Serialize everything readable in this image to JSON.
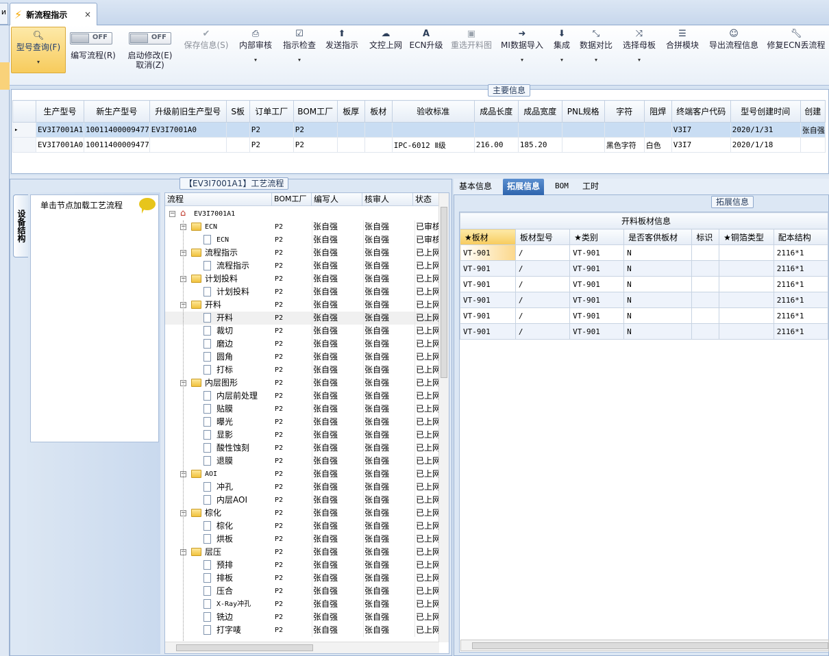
{
  "window": {
    "left_tab_label": "и",
    "tab_title": "新流程指示",
    "close_glyph": "×"
  },
  "toolbar": {
    "query": {
      "label": "型号查询(F)",
      "icon": "search-icon"
    },
    "write_flow": {
      "label": "编写流程(R)",
      "toggle": "OFF"
    },
    "start_modify": {
      "label": "启动修改(E)",
      "label2": "取消(Z)",
      "toggle": "OFF"
    },
    "save_info": {
      "label": "保存信息(S)",
      "disabled": true
    },
    "internal_review": {
      "label": "内部审核"
    },
    "instruction_check": {
      "label": "指示检查"
    },
    "send_instruction": {
      "label": "发送指示"
    },
    "doc_upload": {
      "label": "文控上网"
    },
    "ecn_upgrade": {
      "label": "ECN升级"
    },
    "reselect_cut": {
      "label": "重选开料图",
      "disabled": true
    },
    "mi_import": {
      "label": "MI数据导入"
    },
    "integrate": {
      "label": "集成"
    },
    "data_compare": {
      "label": "数据对比"
    },
    "select_mother": {
      "label": "选择母板"
    },
    "merge_module": {
      "label": "合拼模块"
    },
    "export_flow": {
      "label": "导出流程信息"
    },
    "fix_ecn": {
      "label": "修复ECN丢流程"
    },
    "dropdown_glyph": "▾"
  },
  "main_info": {
    "title": "主要信息",
    "headers": [
      "生产型号",
      "新生产型号",
      "升级前旧生产型号",
      "S板",
      "订单工厂",
      "BOM工厂",
      "板厚",
      "板材",
      "验收标准",
      "成品长度",
      "成品宽度",
      "PNL规格",
      "字符",
      "阻焊",
      "终端客户代码",
      "型号创建时间",
      "创建"
    ],
    "rows": [
      [
        "EV3I7001A1",
        "10011400009477",
        "EV3I7001A0",
        "",
        "P2",
        "P2",
        "",
        "",
        "",
        "",
        "",
        "",
        "",
        "",
        "V3I7",
        "2020/1/31",
        "张自强"
      ],
      [
        "EV3I7001A0",
        "10011400009477",
        "",
        "",
        "P2",
        "P2",
        "",
        "",
        "IPC-6012 Ⅱ级",
        "216.00",
        "185.20",
        "",
        "黑色字符",
        "白色",
        "V3I7",
        "2020/1/18",
        ""
      ]
    ],
    "row_marker": "▸"
  },
  "left_panel": {
    "vertical_tab": "设备结构",
    "prompt": "单击节点加载工艺流程"
  },
  "process": {
    "title": "【EV3I7001A1】工艺流程",
    "headers": [
      "流程",
      "BOM工厂",
      "编写人",
      "核审人",
      "状态"
    ],
    "root": "EV3I7001A1",
    "nodes": [
      {
        "name": "ECN",
        "folder": true,
        "bom": "P2",
        "writer": "张自强",
        "reviewer": "张自强",
        "status": "已审核"
      },
      {
        "name": "ECN",
        "folder": false,
        "bom": "P2",
        "writer": "张自强",
        "reviewer": "张自强",
        "status": "已审核"
      },
      {
        "name": "流程指示",
        "folder": true,
        "bom": "P2",
        "writer": "张自强",
        "reviewer": "张自强",
        "status": "已上网"
      },
      {
        "name": "流程指示",
        "folder": false,
        "bom": "P2",
        "writer": "张自强",
        "reviewer": "张自强",
        "status": "已上网"
      },
      {
        "name": "计划投料",
        "folder": true,
        "bom": "P2",
        "writer": "张自强",
        "reviewer": "张自强",
        "status": "已上网"
      },
      {
        "name": "计划投料",
        "folder": false,
        "bom": "P2",
        "writer": "张自强",
        "reviewer": "张自强",
        "status": "已上网"
      },
      {
        "name": "开料",
        "folder": true,
        "bom": "P2",
        "writer": "张自强",
        "reviewer": "张自强",
        "status": "已上网"
      },
      {
        "name": "开料",
        "folder": false,
        "bom": "P2",
        "writer": "张自强",
        "reviewer": "张自强",
        "status": "已上网"
      },
      {
        "name": "裁切",
        "folder": false,
        "bom": "P2",
        "writer": "张自强",
        "reviewer": "张自强",
        "status": "已上网"
      },
      {
        "name": "磨边",
        "folder": false,
        "bom": "P2",
        "writer": "张自强",
        "reviewer": "张自强",
        "status": "已上网"
      },
      {
        "name": "圆角",
        "folder": false,
        "bom": "P2",
        "writer": "张自强",
        "reviewer": "张自强",
        "status": "已上网"
      },
      {
        "name": "打标",
        "folder": false,
        "bom": "P2",
        "writer": "张自强",
        "reviewer": "张自强",
        "status": "已上网"
      },
      {
        "name": "内层图形",
        "folder": true,
        "bom": "P2",
        "writer": "张自强",
        "reviewer": "张自强",
        "status": "已上网"
      },
      {
        "name": "内层前处理",
        "folder": false,
        "bom": "P2",
        "writer": "张自强",
        "reviewer": "张自强",
        "status": "已上网"
      },
      {
        "name": "贴膜",
        "folder": false,
        "bom": "P2",
        "writer": "张自强",
        "reviewer": "张自强",
        "status": "已上网"
      },
      {
        "name": "曝光",
        "folder": false,
        "bom": "P2",
        "writer": "张自强",
        "reviewer": "张自强",
        "status": "已上网"
      },
      {
        "name": "显影",
        "folder": false,
        "bom": "P2",
        "writer": "张自强",
        "reviewer": "张自强",
        "status": "已上网"
      },
      {
        "name": "酸性蚀刻",
        "folder": false,
        "bom": "P2",
        "writer": "张自强",
        "reviewer": "张自强",
        "status": "已上网"
      },
      {
        "name": "退膜",
        "folder": false,
        "bom": "P2",
        "writer": "张自强",
        "reviewer": "张自强",
        "status": "已上网"
      },
      {
        "name": "AOI",
        "folder": true,
        "bom": "P2",
        "writer": "张自强",
        "reviewer": "张自强",
        "status": "已上网"
      },
      {
        "name": "冲孔",
        "folder": false,
        "bom": "P2",
        "writer": "张自强",
        "reviewer": "张自强",
        "status": "已上网"
      },
      {
        "name": "内层AOI",
        "folder": false,
        "bom": "P2",
        "writer": "张自强",
        "reviewer": "张自强",
        "status": "已上网"
      },
      {
        "name": "棕化",
        "folder": true,
        "bom": "P2",
        "writer": "张自强",
        "reviewer": "张自强",
        "status": "已上网"
      },
      {
        "name": "棕化",
        "folder": false,
        "bom": "P2",
        "writer": "张自强",
        "reviewer": "张自强",
        "status": "已上网"
      },
      {
        "name": "烘板",
        "folder": false,
        "bom": "P2",
        "writer": "张自强",
        "reviewer": "张自强",
        "status": "已上网"
      },
      {
        "name": "层压",
        "folder": true,
        "bom": "P2",
        "writer": "张自强",
        "reviewer": "张自强",
        "status": "已上网"
      },
      {
        "name": "预排",
        "folder": false,
        "bom": "P2",
        "writer": "张自强",
        "reviewer": "张自强",
        "status": "已上网"
      },
      {
        "name": "排板",
        "folder": false,
        "bom": "P2",
        "writer": "张自强",
        "reviewer": "张自强",
        "status": "已上网"
      },
      {
        "name": "压合",
        "folder": false,
        "bom": "P2",
        "writer": "张自强",
        "reviewer": "张自强",
        "status": "已上网"
      },
      {
        "name": "X-Ray冲孔",
        "folder": false,
        "bom": "P2",
        "writer": "张自强",
        "reviewer": "张自强",
        "status": "已上网"
      },
      {
        "name": "铣边",
        "folder": false,
        "bom": "P2",
        "writer": "张自强",
        "reviewer": "张自强",
        "status": "已上网"
      },
      {
        "name": "打字唛",
        "folder": false,
        "bom": "P2",
        "writer": "张自强",
        "reviewer": "张自强",
        "status": "已上网"
      }
    ]
  },
  "right_panel": {
    "tabs": [
      "基本信息",
      "拓展信息",
      "BOM",
      "工时"
    ],
    "active_tab": 1,
    "group_title": "拓展信息",
    "table_title": "开料板材信息",
    "headers": [
      "★板材",
      "板材型号",
      "★类别",
      "是否客供板材",
      "标识",
      "★铜箔类型",
      "配本结构"
    ],
    "rows": [
      [
        "VT-901",
        "/",
        "VT-901",
        "N",
        "",
        "",
        "2116*1"
      ],
      [
        "VT-901",
        "/",
        "VT-901",
        "N",
        "",
        "",
        "2116*1"
      ],
      [
        "VT-901",
        "/",
        "VT-901",
        "N",
        "",
        "",
        "2116*1"
      ],
      [
        "VT-901",
        "/",
        "VT-901",
        "N",
        "",
        "",
        "2116*1"
      ],
      [
        "VT-901",
        "/",
        "VT-901",
        "N",
        "",
        "",
        "2116*1"
      ],
      [
        "VT-901",
        "/",
        "VT-901",
        "N",
        "",
        "",
        "2116*1"
      ]
    ]
  },
  "colors": {
    "accent": "#2e64ad",
    "highlight": "#f7cb5c",
    "selected_row": "#c9ddf3"
  }
}
